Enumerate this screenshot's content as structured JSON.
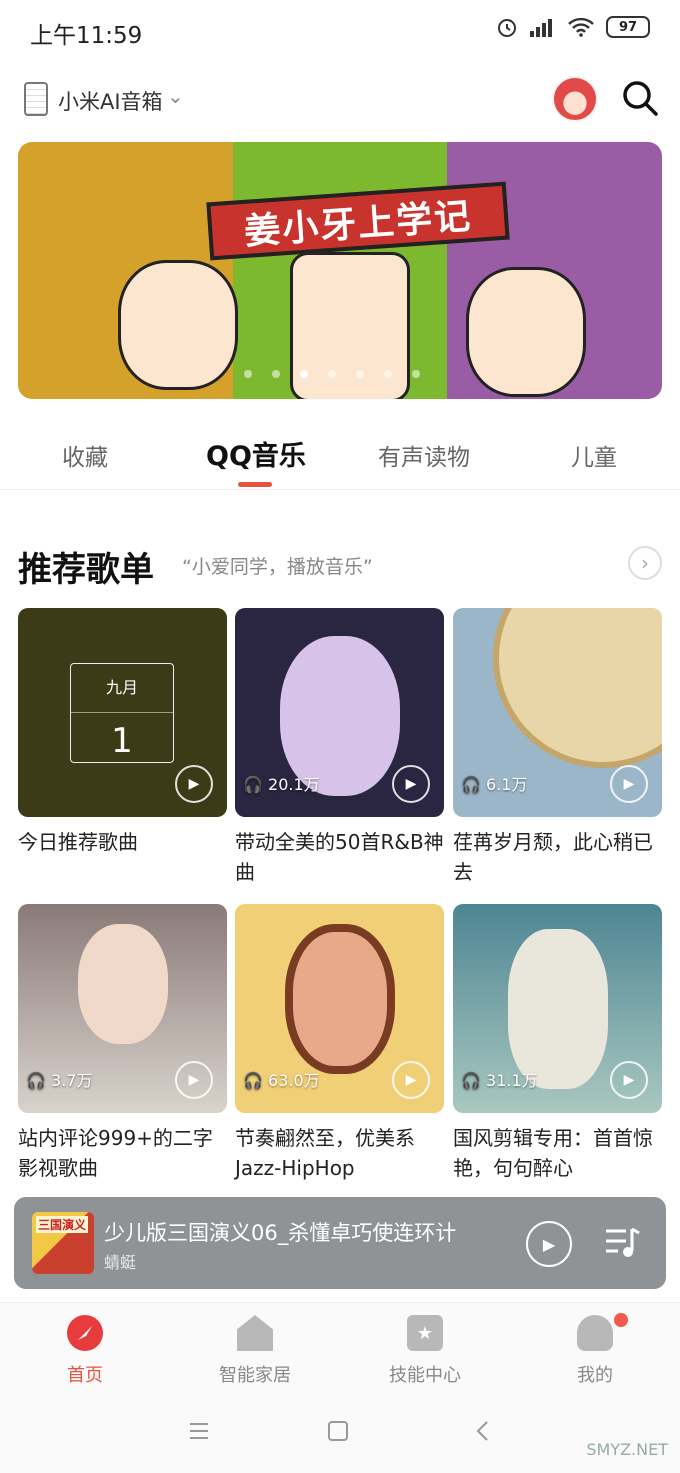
{
  "status": {
    "time": "上午11:59",
    "battery": "97"
  },
  "header": {
    "device_name": "小米AI音箱"
  },
  "banner": {
    "title": "姜小牙上学记",
    "total_dots": 7,
    "active_dot": 2
  },
  "tabs": [
    {
      "label": "收藏"
    },
    {
      "label": "QQ音乐"
    },
    {
      "label": "有声读物"
    },
    {
      "label": "儿童"
    }
  ],
  "section": {
    "title": "推荐歌单",
    "subtitle": "“小爱同学，播放音乐”"
  },
  "playlists": [
    {
      "title": "今日推荐歌曲",
      "count": "",
      "date_month": "九月",
      "date_day": "1",
      "bg": "#3d3a17"
    },
    {
      "title": "带动全美的50首R&B神曲",
      "count": "20.1万",
      "bg": "#2a2540"
    },
    {
      "title": "荏苒岁月颓，此心稍已去",
      "count": "6.1万",
      "bg": "#9bb6c9"
    },
    {
      "title": "站内评论999+的二字影视歌曲",
      "count": "3.7万",
      "bg": "#6b5b58"
    },
    {
      "title": "节奏翩然至，优美系Jazz-HipHop",
      "count": "63.0万",
      "bg": "#e8b95a"
    },
    {
      "title": "国风剪辑专用：首首惊艳，句句醉心",
      "count": "31.1万",
      "bg": "#5e8f99"
    }
  ],
  "mini_player": {
    "title": "少儿版三国演义06_杀懂卓巧使连环计",
    "artist": "蜻蜓",
    "thumb_label": "三国演义"
  },
  "bottom_nav": [
    {
      "label": "首页",
      "active": true
    },
    {
      "label": "智能家居",
      "active": false
    },
    {
      "label": "技能中心",
      "active": false
    },
    {
      "label": "我的",
      "active": false
    }
  ],
  "watermark": "SMYZ.NET",
  "colors": {
    "accent": "#e8533f",
    "mini_player_bg": "#8f9396"
  }
}
